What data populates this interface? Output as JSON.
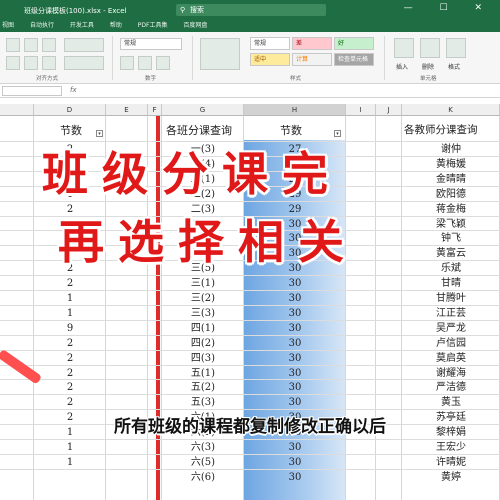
{
  "titlebar": {
    "doc_title": "班级分课模板(100).xlsx - Excel",
    "search": "搜索",
    "window_controls": "— ☐ ✕"
  },
  "menu": [
    "视图",
    "自动执行",
    "开发工具",
    "帮助",
    "PDF工具集",
    "百度网盘"
  ],
  "ribbon": {
    "groups": [
      "对齐方式",
      "数字",
      "样式",
      "单元格"
    ],
    "number_format": "常规",
    "styles": [
      "常规",
      "差",
      "好",
      "适中",
      "计算",
      "检查单元格"
    ],
    "cells_buttons": [
      "插入",
      "删除",
      "格式"
    ]
  },
  "columns": [
    "D",
    "E",
    "F",
    "G",
    "H",
    "I",
    "J",
    "K"
  ],
  "headers": {
    "d": "节数",
    "g": "各班分课查询",
    "h": "节数",
    "k": "各教师分课查询"
  },
  "rows": [
    {
      "d": "2",
      "g": "一(3)",
      "h": "27",
      "k": "谢仲"
    },
    {
      "d": "",
      "g": "一(4)",
      "h": "27",
      "k": "黄梅媛"
    },
    {
      "d": "",
      "g": "二(1)",
      "h": "27",
      "k": "金晴晴"
    },
    {
      "d": "1",
      "g": "二(2)",
      "h": "29",
      "k": "欧阳德"
    },
    {
      "d": "2",
      "g": "二(3)",
      "h": "29",
      "k": "蒋金梅"
    },
    {
      "d": "",
      "g": "二(4)",
      "h": "30",
      "k": "梁飞颖"
    },
    {
      "d": "",
      "g": "二(5)",
      "h": "30",
      "k": "钟飞"
    },
    {
      "d": "",
      "g": "三(1)",
      "h": "30",
      "k": "黄富云"
    },
    {
      "d": "2",
      "g": "三(5)",
      "h": "30",
      "k": "乐斌"
    },
    {
      "d": "2",
      "g": "三(1)",
      "h": "30",
      "k": "甘晴"
    },
    {
      "d": "1",
      "g": "三(2)",
      "h": "30",
      "k": "甘腾叶"
    },
    {
      "d": "1",
      "g": "三(3)",
      "h": "30",
      "k": "江正芸"
    },
    {
      "d": "9",
      "g": "四(1)",
      "h": "30",
      "k": "吴严龙"
    },
    {
      "d": "2",
      "g": "四(2)",
      "h": "30",
      "k": "卢信园"
    },
    {
      "d": "2",
      "g": "四(3)",
      "h": "30",
      "k": "莫启英"
    },
    {
      "d": "2",
      "g": "五(1)",
      "h": "30",
      "k": "谢耀海"
    },
    {
      "d": "2",
      "g": "五(2)",
      "h": "30",
      "k": "严洁德"
    },
    {
      "d": "2",
      "g": "五(3)",
      "h": "30",
      "k": "黄玉"
    },
    {
      "d": "2",
      "g": "六(1)",
      "h": "30",
      "k": "苏亭廷"
    },
    {
      "d": "1",
      "g": "六(2)",
      "h": "30",
      "k": "黎梓娟"
    },
    {
      "d": "1",
      "g": "六(3)",
      "h": "30",
      "k": "王宏少"
    },
    {
      "d": "1",
      "g": "六(5)",
      "h": "30",
      "k": "许晴妮"
    },
    {
      "d": "",
      "g": "六(6)",
      "h": "30",
      "k": "黄婷"
    }
  ],
  "overlay": {
    "line1": "班级分课完",
    "line2": "再选择相关",
    "caption": "所有班级的课程都复制修改正确以后"
  },
  "colors": {
    "accent_green": "#1f6e43",
    "overlay_red": "#e01818",
    "selection_blue": "#6ea6e2"
  }
}
